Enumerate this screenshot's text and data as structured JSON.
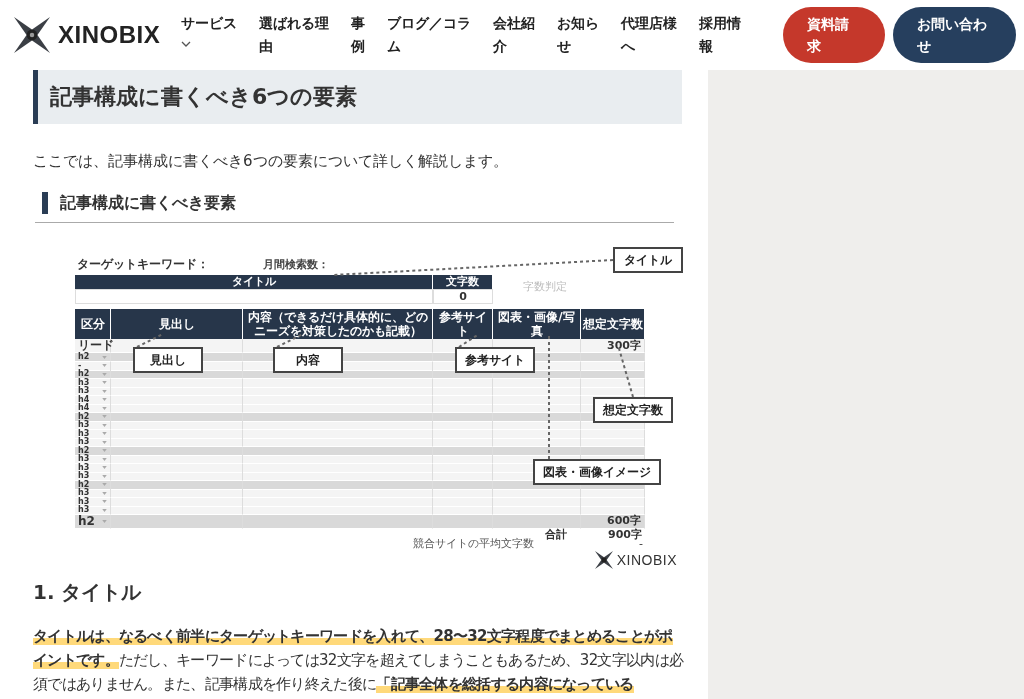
{
  "header": {
    "logo": "XINOBIX",
    "nav": [
      {
        "label": "サービス",
        "dropdown": true
      },
      {
        "label": "選ばれる理由",
        "dropdown": false
      },
      {
        "label": "事例",
        "dropdown": false
      },
      {
        "label": "ブログ／コラム",
        "dropdown": false
      },
      {
        "label": "会社紹介",
        "dropdown": false
      },
      {
        "label": "お知らせ",
        "dropdown": false
      },
      {
        "label": "代理店様へ",
        "dropdown": false
      },
      {
        "label": "採用情報",
        "dropdown": false
      }
    ],
    "buttons": [
      {
        "label": "資料請求",
        "kind": "primary"
      },
      {
        "label": "お問い合わせ",
        "kind": "secondary"
      }
    ]
  },
  "article": {
    "heading": "記事構成に書くべき6つの要素",
    "intro": "ここでは、記事構成に書くべき6つの要素について詳しく解説します。",
    "subheading": "記事構成に書くべき要素",
    "figure": {
      "keyword_label": "ターゲットキーワード：",
      "volume_label": "月間検索数：",
      "title_header": "タイトル",
      "count_header": "文字数",
      "count_value": "0",
      "judge_label": "字数判定",
      "columns": [
        "区分",
        "見出し",
        "内容（できるだけ具体的に、どのニーズを対策したのかも記載）",
        "参考サイト",
        "図表・画像/写真",
        "想定文字数"
      ],
      "rows": [
        {
          "label": "リード",
          "shaded": false,
          "chars": "300字"
        },
        {
          "label": "h2",
          "shaded": true
        },
        {
          "label": "-",
          "shaded": false
        },
        {
          "label": "h2",
          "shaded": true
        },
        {
          "label": "h3",
          "shaded": false
        },
        {
          "label": "h3",
          "shaded": false
        },
        {
          "label": "h4",
          "shaded": false
        },
        {
          "label": "h4",
          "shaded": false
        },
        {
          "label": "h2",
          "shaded": true
        },
        {
          "label": "h3",
          "shaded": false
        },
        {
          "label": "h3",
          "shaded": false
        },
        {
          "label": "h3",
          "shaded": false
        },
        {
          "label": "h2",
          "shaded": true
        },
        {
          "label": "h3",
          "shaded": false
        },
        {
          "label": "h3",
          "shaded": false
        },
        {
          "label": "h3",
          "shaded": false
        },
        {
          "label": "h2",
          "shaded": true
        },
        {
          "label": "h3",
          "shaded": false
        },
        {
          "label": "h3",
          "shaded": false
        },
        {
          "label": "h3",
          "shaded": false
        },
        {
          "label": "h2",
          "shaded": true,
          "chars": "600字"
        }
      ],
      "total_label": "合計",
      "total_value": "900字",
      "average_label": "競合サイトの平均文字数",
      "average_value": "-",
      "callouts": [
        "タイトル",
        "見出し",
        "内容",
        "参考サイト",
        "想定文字数",
        "図表・画像イメージ"
      ],
      "logo": "XINOBIX"
    },
    "section_title": "1. タイトル",
    "paragraph": "**タイトルは、なるべく前半にターゲットキーワードを入れて、28〜32文字程度でまとめることがポイントです。**ただし、キーワードによっては32文字を超えてしまうこともあるため、32文字以内は必須ではありません。また、記事構成を作り終えた後に**「記事全体を総括する内容になっている**"
  }
}
